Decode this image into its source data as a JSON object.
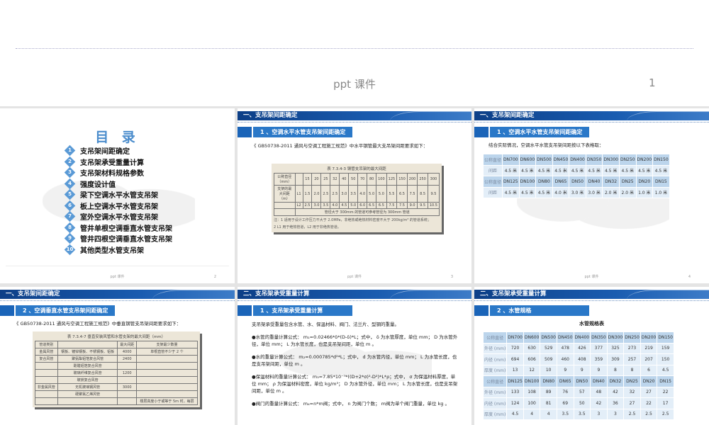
{
  "top": {
    "footer": "ppt 课件",
    "page": "1"
  },
  "common": {
    "footer": "ppt 课件"
  },
  "s2": {
    "title": "目 录",
    "page": "2",
    "items": [
      "支吊架间距确定",
      "支吊架承受重量计算",
      "支吊架材料规格参数",
      "强度设计值",
      "梁下空调水平水管支吊架",
      "板上空调水平水管支吊架",
      "室外空调水平水管支吊架",
      "管井单根空调垂直水管支吊架",
      "管井四根空调垂直水管支吊架",
      "其他类型水管支吊架"
    ]
  },
  "s3": {
    "header": "一、支吊架间距确定",
    "sub": "1 、空调水平水管支吊架间距确定",
    "page": "3",
    "text": "《 GB50738-2011 通风与空调工程施工规范》中水平钢管最大支吊架间距要求如下：",
    "table": {
      "caption": "表 7.3.4-3  钢管支吊架的最大间距",
      "rows": [
        [
          "公称直径（mm）",
          "",
          "15",
          "20",
          "25",
          "32",
          "40",
          "50",
          "70",
          "80",
          "100",
          "125",
          "150",
          "200",
          "250",
          "300"
        ],
        [
          "支架的最大间距（m）",
          "L1",
          "1.5",
          "2.0",
          "2.5",
          "2.5",
          "3.0",
          "3.5",
          "4.0",
          "5.0",
          "5.0",
          "5.5",
          "6.5",
          "7.5",
          "8.5",
          "9.5"
        ],
        [
          "",
          "L2",
          "2.5",
          "3.0",
          "3.5",
          "4.0",
          "4.5",
          "5.0",
          "6.0",
          "6.5",
          "6.5",
          "7.5",
          "7.5",
          "9.0",
          "9.5",
          "10.5"
        ],
        [
          "",
          "管径大于 300mm 的管道可参考管径为 300mm 管道"
        ]
      ],
      "notes": [
        "注：1  适用于设计工作压力不大于 2.0MPa，非绝热或绝热材料密度不大于 200kg/m³ 的管道系统；",
        "2  L1 用于绝热管道，L2 用于非绝热管道。"
      ]
    }
  },
  "s4": {
    "header": "一、支吊架间距确定",
    "sub": "1 、空调水平水管支吊架间距确定",
    "page": "4",
    "text": "结合实际情况，空调水平水管支吊架间距按以下表格取：",
    "rows": [
      [
        "公称直径",
        "DN700",
        "DN600",
        "DN500",
        "DN450",
        "DN400",
        "DN350",
        "DN300",
        "DN250",
        "DN200",
        "DN150"
      ],
      [
        "间距",
        "4.5 米",
        "4.5 米",
        "4.5 米",
        "4.5 米",
        "4.5 米",
        "4.5 米",
        "4.5 米",
        "4.5 米",
        "4.5 米",
        "4.5 米"
      ],
      [
        "公称直径",
        "DN125",
        "DN100",
        "DN80",
        "DN65",
        "DN50",
        "DN40",
        "DN32",
        "DN25",
        "DN20",
        "DN15"
      ],
      [
        "间距",
        "4.5 米",
        "4.5 米",
        "4.5 米",
        "4.0 米",
        "3.0 米",
        "3.0 米",
        "2.0 米",
        "2.0 米",
        "1.0 米",
        "1.0 米"
      ]
    ]
  },
  "s5": {
    "header": "一、支吊架间距确定",
    "sub": "2 、空调垂直水管支吊架间距确定",
    "text": "《 GB50738-2011 通风与空调工程施工规范》中垂直钢管支吊架间距要求如下：",
    "table": {
      "caption": "表 7.3.4-7  垂直安装风管和水管支架的最大间距（mm）",
      "rows": [
        [
          "管道类别",
          "",
          "最大间距",
          "支架最少数量"
        ],
        [
          "金属风管",
          "钢板、镀锌钢板、不锈钢板、铝板",
          "4000",
          "单根直管不少于 2 个"
        ],
        [
          "复合风管",
          "聚氨酯铝箔复合风管",
          "2400",
          ""
        ],
        [
          "",
          "酚醛铝箔复合风管",
          "",
          ""
        ],
        [
          "",
          "玻璃纤维复合风管",
          "1200",
          ""
        ],
        [
          "",
          "玻镁复合风管",
          "",
          ""
        ],
        [
          "非金属风管",
          "无机玻璃钢风管",
          "3000",
          ""
        ],
        [
          "",
          "硬聚氯乙烯风管",
          "",
          ""
        ],
        [
          "",
          "",
          "",
          "楼层高度小于或等于 5m 时，每层"
        ]
      ]
    }
  },
  "s6": {
    "header": "二、支吊架承受重量计算",
    "sub": "1 、支吊架承受重量计算",
    "paras": [
      "支吊架承受重量包含水管、水、保温材料、阀门、法兰片、型钢的重量。",
      "●水管的重量计算公式： m₁=0.02466*δ*(D-δ)*L；式中， δ 为水管厚度，单位 mm； D 为水管外径，单位 mm； L 为水管长度，也是支吊架间距，单位 m 。",
      "●水的重量计算公式： m₂=0.000785*d²*L；式中， d 为水管内径，单位 mm； L 为水管长度，也是支吊架间距，单位 m 。",
      "●保温材料的重量计算公式： m₃=7.85*10⁻⁷*((D+2*σ)²-D²)*L*ρ；式中， σ 为保温材料厚度，单位 mm； ρ 为保温材料密度，单位 kg/m³； D 为水管外径，单位 mm； L 为水管长度，也是支吊架间距，单位 m 。",
      "●阀门的重量计算公式： m₄=n*m阀；式中， n 为阀门个数； m阀为单个阀门重量，单位 kg 。"
    ]
  },
  "s7": {
    "header": "二、支吊架承受重量计算",
    "sub": "2 、水管规格",
    "title": "水管规格表",
    "rows": [
      [
        "公称直径",
        "DN700",
        "DN600",
        "DN500",
        "DN450",
        "DN400",
        "DN350",
        "DN300",
        "DN250",
        "DN200",
        "DN150"
      ],
      [
        "外径 (mm)",
        "720",
        "630",
        "529",
        "478",
        "426",
        "377",
        "325",
        "273",
        "219",
        "159"
      ],
      [
        "内径 (mm)",
        "694",
        "606",
        "509",
        "460",
        "408",
        "359",
        "309",
        "257",
        "207",
        "150"
      ],
      [
        "厚度 (mm)",
        "13",
        "12",
        "10",
        "9",
        "9",
        "9",
        "8",
        "8",
        "6",
        "4.5"
      ],
      [
        "公称直径",
        "DN125",
        "DN100",
        "DN80",
        "DN65",
        "DN50",
        "DN40",
        "DN32",
        "DN25",
        "DN20",
        "DN15"
      ],
      [
        "外径 (mm)",
        "133",
        "108",
        "89",
        "76",
        "57",
        "48",
        "42",
        "32",
        "27",
        "22"
      ],
      [
        "内径 (mm)",
        "124",
        "100",
        "81",
        "69",
        "50",
        "42",
        "36",
        "27",
        "22",
        "17"
      ],
      [
        "厚度 (mm)",
        "4.5",
        "4",
        "4",
        "3.5",
        "3.5",
        "3",
        "3",
        "2.5",
        "2.5",
        "2.5"
      ]
    ]
  }
}
